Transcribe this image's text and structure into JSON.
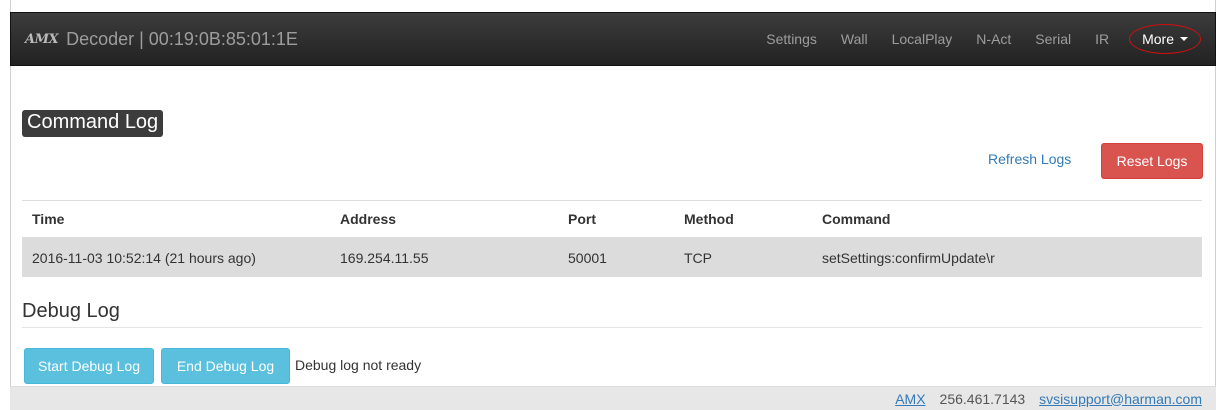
{
  "header": {
    "logo_text": "AMX",
    "title": "Decoder | 00:19:0B:85:01:1E",
    "nav_items": [
      "Settings",
      "Wall",
      "LocalPlay",
      "N-Act",
      "Serial",
      "IR"
    ],
    "more_label": "More"
  },
  "command_log": {
    "title": "Command Log",
    "refresh_label": "Refresh Logs",
    "reset_label": "Reset Logs",
    "columns": {
      "time": "Time",
      "address": "Address",
      "port": "Port",
      "method": "Method",
      "command": "Command"
    },
    "rows": [
      {
        "time": "2016-11-03 10:52:14 (21 hours ago)",
        "address": "169.254.11.55",
        "port": "50001",
        "method": "TCP",
        "command": "setSettings:confirmUpdate\\r"
      }
    ]
  },
  "debug_log": {
    "title": "Debug Log",
    "start_label": "Start Debug Log",
    "end_label": "End Debug Log",
    "status": "Debug log not ready"
  },
  "footer": {
    "brand_link": "AMX",
    "phone": "256.461.7143",
    "email": "svsisupport@harman.com"
  },
  "colors": {
    "navbar": "#2b2b2b",
    "reset_button": "#d9534f",
    "info_button": "#5bc0de",
    "link": "#337ab7",
    "more_highlight": "#cc1111"
  }
}
